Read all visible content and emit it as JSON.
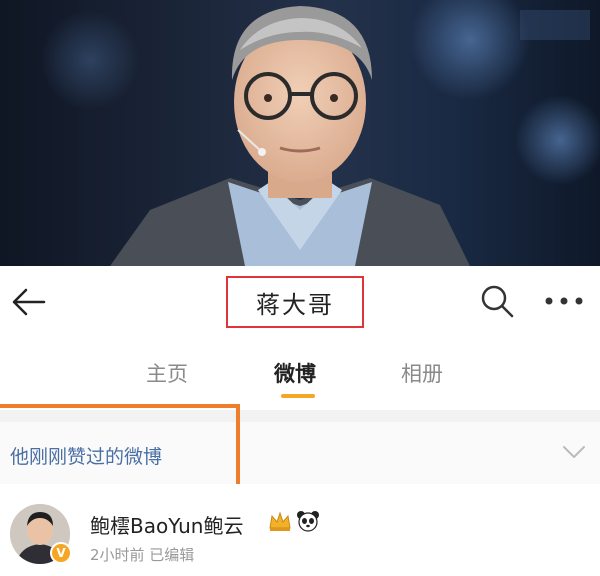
{
  "header": {
    "title": "蒋大哥",
    "back_icon": "back-arrow-icon",
    "search_icon": "search-icon",
    "more_icon": "more-icon"
  },
  "tabs": [
    {
      "label": "主页",
      "active": false
    },
    {
      "label": "微博",
      "active": true
    },
    {
      "label": "相册",
      "active": false
    }
  ],
  "liked_section": {
    "label": "他刚刚赞过的微博",
    "chevron_icon": "chevron-down-icon"
  },
  "post": {
    "author": "鲍橒BaoYun鲍云",
    "meta": "2小时前  已编辑",
    "badge": "V",
    "badge_icons": [
      "crown-icon",
      "panda-icon"
    ]
  },
  "colors": {
    "title_highlight": "#e0333a",
    "section_highlight": "#ef7d2e",
    "tab_underline": "#f5a623",
    "link_blue": "#4a6fa5"
  }
}
